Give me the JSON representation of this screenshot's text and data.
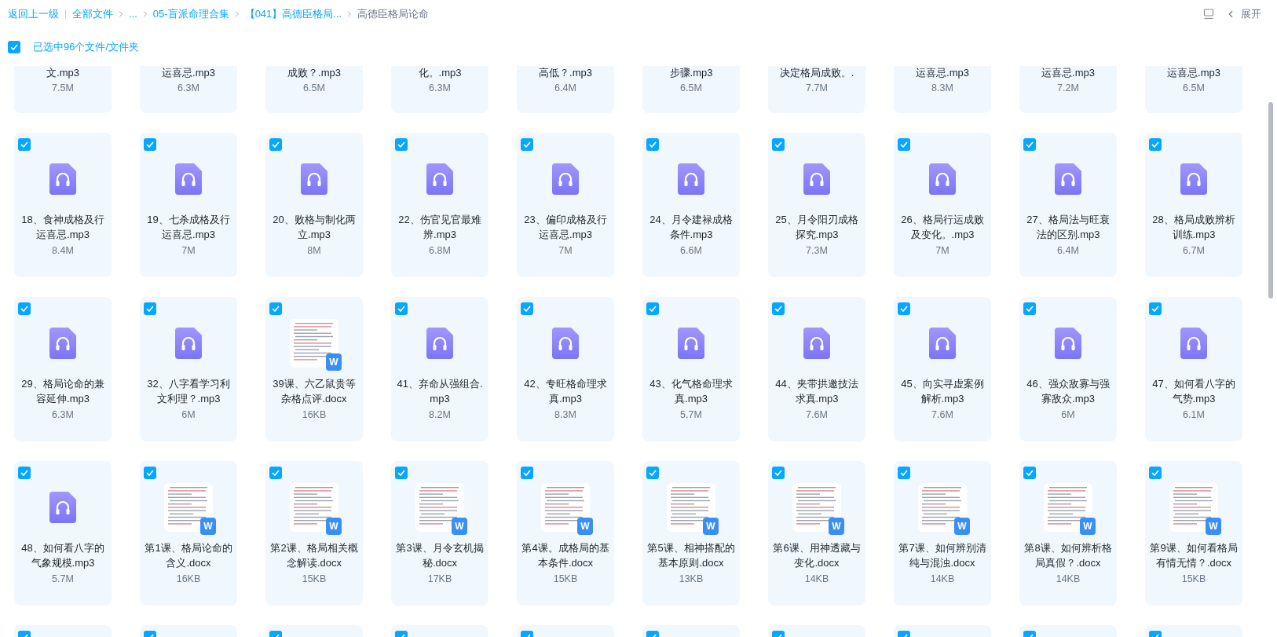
{
  "breadcrumb": {
    "back": "返回上一级",
    "items": [
      {
        "label": "全部文件"
      },
      {
        "label": "..."
      },
      {
        "label": "05-盲派命理合集"
      },
      {
        "label": "【041】高德臣格局..."
      }
    ],
    "current": "高德臣格局论命"
  },
  "toolbar": {
    "expand": "展开"
  },
  "selection": {
    "checked": true,
    "label": "已选中96个文件/文件夹"
  },
  "rows": [
    {
      "kind": "partial",
      "files": [
        {
          "name": "文.mp3",
          "size": "7.5M"
        },
        {
          "name": "运喜忌.mp3",
          "size": "6.3M"
        },
        {
          "name": "成败？.mp3",
          "size": "6.5M"
        },
        {
          "name": "化。.mp3",
          "size": "6.3M"
        },
        {
          "name": "高低？.mp3",
          "size": "6.4M"
        },
        {
          "name": "步骤.mp3",
          "size": "6.5M"
        },
        {
          "name": "决定格局成败。.",
          "size": "7.7M"
        },
        {
          "name": "运喜忌.mp3",
          "size": "8.3M"
        },
        {
          "name": "运喜忌.mp3",
          "size": "7.2M"
        },
        {
          "name": "运喜忌.mp3",
          "size": "6.5M"
        }
      ]
    },
    {
      "kind": "full",
      "files": [
        {
          "kind": "audio",
          "checked": true,
          "name": "18、食神成格及行运喜忌.mp3",
          "size": "8.4M"
        },
        {
          "kind": "audio",
          "checked": true,
          "name": "19、七杀成格及行运喜忌.mp3",
          "size": "7M"
        },
        {
          "kind": "audio",
          "checked": true,
          "name": "20、败格与制化两立.mp3",
          "size": "8M"
        },
        {
          "kind": "audio",
          "checked": true,
          "name": "22、伤官见官最难辨.mp3",
          "size": "6.8M"
        },
        {
          "kind": "audio",
          "checked": true,
          "name": "23、偏印成格及行运喜忌.mp3",
          "size": "7M"
        },
        {
          "kind": "audio",
          "checked": true,
          "name": "24、月令建禄成格条件.mp3",
          "size": "6.6M"
        },
        {
          "kind": "audio",
          "checked": true,
          "name": "25、月令阳刃成格探究.mp3",
          "size": "7.3M"
        },
        {
          "kind": "audio",
          "checked": true,
          "name": "26、格局行运成败及变化。.mp3",
          "size": "7M"
        },
        {
          "kind": "audio",
          "checked": true,
          "name": "27、格局法与旺衰法的区别.mp3",
          "size": "6.4M"
        },
        {
          "kind": "audio",
          "checked": true,
          "name": "28、格局成败辨析训练.mp3",
          "size": "6.7M"
        }
      ]
    },
    {
      "kind": "full",
      "files": [
        {
          "kind": "audio",
          "checked": true,
          "name": "29、格局论命的兼容延伸.mp3",
          "size": "6.3M"
        },
        {
          "kind": "audio",
          "checked": true,
          "name": "32、八字看学习利文利理？.mp3",
          "size": "6M"
        },
        {
          "kind": "doc",
          "checked": true,
          "badge": "W",
          "name": "39课、六乙鼠贵等杂格点评.docx",
          "size": "16KB"
        },
        {
          "kind": "audio",
          "checked": true,
          "name": "41、弃命从强组合.mp3",
          "size": "8.2M"
        },
        {
          "kind": "audio",
          "checked": true,
          "name": "42、专旺格命理求真.mp3",
          "size": "8.3M"
        },
        {
          "kind": "audio",
          "checked": true,
          "name": "43、化气格命理求真.mp3",
          "size": "5.7M"
        },
        {
          "kind": "audio",
          "checked": true,
          "name": "44、夹带拱邀技法求真.mp3",
          "size": "7.6M"
        },
        {
          "kind": "audio",
          "checked": true,
          "name": "45、向实寻虚案例解析.mp3",
          "size": "7.6M"
        },
        {
          "kind": "audio",
          "checked": true,
          "name": "46、强众敌寡与强寡敌众.mp3",
          "size": "6M"
        },
        {
          "kind": "audio",
          "checked": true,
          "name": "47、如何看八字的气势.mp3",
          "size": "6.1M"
        }
      ]
    },
    {
      "kind": "full",
      "files": [
        {
          "kind": "audio",
          "checked": true,
          "name": "48、如何看八字的气象规模.mp3",
          "size": "5.7M"
        },
        {
          "kind": "doc",
          "checked": true,
          "badge": "W",
          "name": "第1课、格局论命的含义.docx",
          "size": "16KB"
        },
        {
          "kind": "doc",
          "checked": true,
          "badge": "W",
          "name": "第2课、格局相关概念解读.docx",
          "size": "15KB"
        },
        {
          "kind": "doc",
          "checked": true,
          "badge": "W",
          "name": "第3课、月令玄机揭秘.docx",
          "size": "17KB"
        },
        {
          "kind": "doc",
          "checked": true,
          "badge": "W",
          "name": "第4课。成格局的基本条件.docx",
          "size": "15KB"
        },
        {
          "kind": "doc",
          "checked": true,
          "badge": "W",
          "name": "第5课、相神搭配的基本原则.docx",
          "size": "13KB"
        },
        {
          "kind": "doc",
          "checked": true,
          "badge": "W",
          "name": "第6课、用神透藏与变化.docx",
          "size": "14KB"
        },
        {
          "kind": "doc",
          "checked": true,
          "badge": "W",
          "name": "第7课、如何辨别清纯与混浊.docx",
          "size": "14KB"
        },
        {
          "kind": "doc",
          "checked": true,
          "badge": "W",
          "name": "第8课、如何辨析格局真假？.docx",
          "size": "14KB"
        },
        {
          "kind": "doc",
          "checked": true,
          "badge": "W",
          "name": "第9课、如何看格局有情无情？.docx",
          "size": "15KB"
        }
      ]
    },
    {
      "kind": "stub",
      "files": [
        {
          "checked": true
        },
        {
          "checked": true
        },
        {
          "checked": true
        },
        {
          "checked": true
        },
        {
          "checked": true
        },
        {
          "checked": true
        },
        {
          "checked": true
        },
        {
          "checked": true
        },
        {
          "checked": true
        },
        {
          "checked": true
        }
      ]
    }
  ]
}
